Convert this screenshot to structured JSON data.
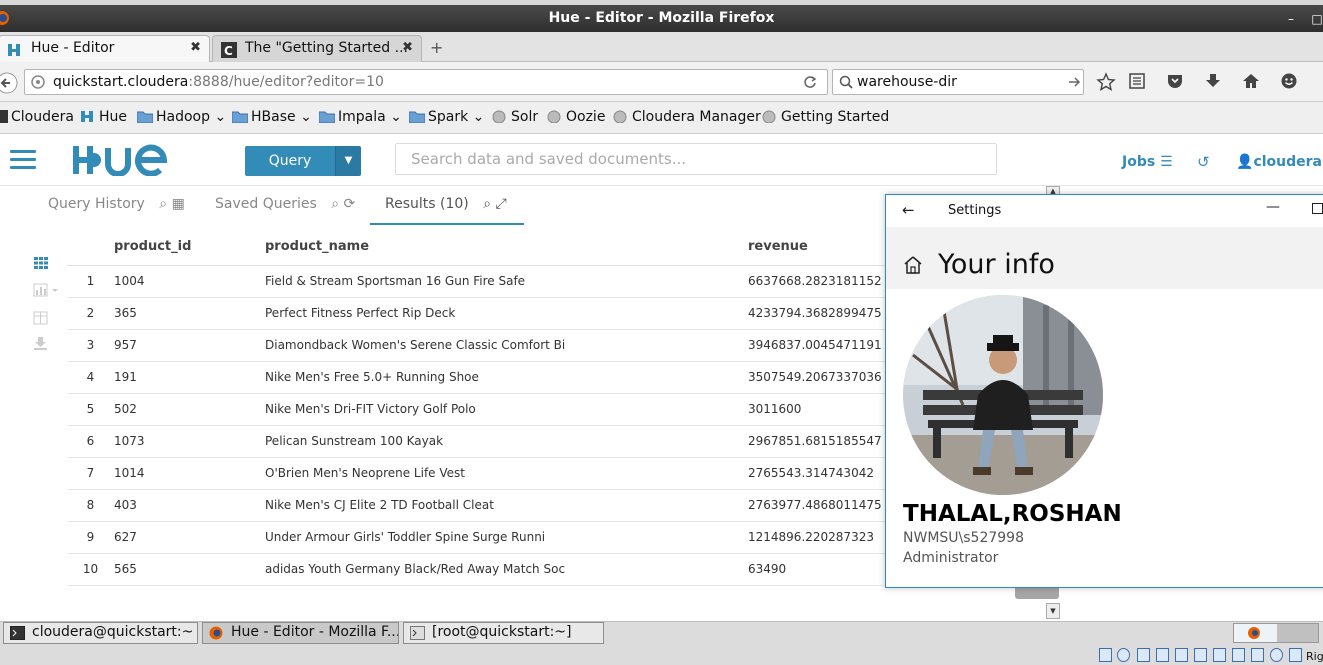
{
  "window": {
    "title": "Hue - Editor - Mozilla Firefox",
    "minimize": "–",
    "maximize": "□"
  },
  "tabs": [
    {
      "label": "Hue - Editor",
      "close": "✖"
    },
    {
      "label": "The \"Getting Started ...",
      "close": "✖"
    }
  ],
  "newtab": "+",
  "navbar": {
    "url_host": "quickstart.cloudera",
    "url_rest": ":8888/hue/editor?editor=10",
    "search_value": "warehouse-dir"
  },
  "bookmarks": [
    "Cloudera",
    "Hue",
    "Hadoop",
    "HBase",
    "Impala",
    "Spark",
    "Solr",
    "Oozie",
    "Cloudera Manager",
    "Getting Started"
  ],
  "hue": {
    "query_button": "Query",
    "search_placeholder": "Search data and saved documents...",
    "jobs": "Jobs",
    "user": "cloudera",
    "subtabs": [
      "Query History",
      "Saved Queries",
      "Results (10)"
    ]
  },
  "results": {
    "columns": [
      "product_id",
      "product_name",
      "revenue"
    ],
    "rows": [
      {
        "n": "1",
        "product_id": "1004",
        "product_name": "Field & Stream Sportsman 16 Gun Fire Safe",
        "revenue": "6637668.2823181152"
      },
      {
        "n": "2",
        "product_id": "365",
        "product_name": "Perfect Fitness Perfect Rip Deck",
        "revenue": "4233794.3682899475"
      },
      {
        "n": "3",
        "product_id": "957",
        "product_name": "Diamondback Women's Serene Classic Comfort Bi",
        "revenue": "3946837.0045471191"
      },
      {
        "n": "4",
        "product_id": "191",
        "product_name": "Nike Men's Free 5.0+ Running Shoe",
        "revenue": "3507549.2067337036"
      },
      {
        "n": "5",
        "product_id": "502",
        "product_name": "Nike Men's Dri-FIT Victory Golf Polo",
        "revenue": "3011600"
      },
      {
        "n": "6",
        "product_id": "1073",
        "product_name": "Pelican Sunstream 100 Kayak",
        "revenue": "2967851.6815185547"
      },
      {
        "n": "7",
        "product_id": "1014",
        "product_name": "O'Brien Men's Neoprene Life Vest",
        "revenue": "2765543.314743042"
      },
      {
        "n": "8",
        "product_id": "403",
        "product_name": "Nike Men's CJ Elite 2 TD Football Cleat",
        "revenue": "2763977.4868011475"
      },
      {
        "n": "9",
        "product_id": "627",
        "product_name": "Under Armour Girls' Toddler Spine Surge Runni",
        "revenue": "1214896.220287323"
      },
      {
        "n": "10",
        "product_id": "565",
        "product_name": "adidas Youth Germany Black/Red Away Match Soc",
        "revenue": "63490"
      }
    ]
  },
  "settings": {
    "window_title": "Settings",
    "heading": "Your info",
    "name": "THALAL,ROSHAN",
    "account": "NWMSU\\s527998",
    "role": "Administrator"
  },
  "taskbar": {
    "items": [
      "cloudera@quickstart:~",
      "Hue - Editor - Mozilla F...",
      "[root@quickstart:~]"
    ],
    "tray_label": "Rig"
  },
  "colors": {
    "hue_blue": "#338bb8",
    "settings_border": "#2b8ad6"
  }
}
